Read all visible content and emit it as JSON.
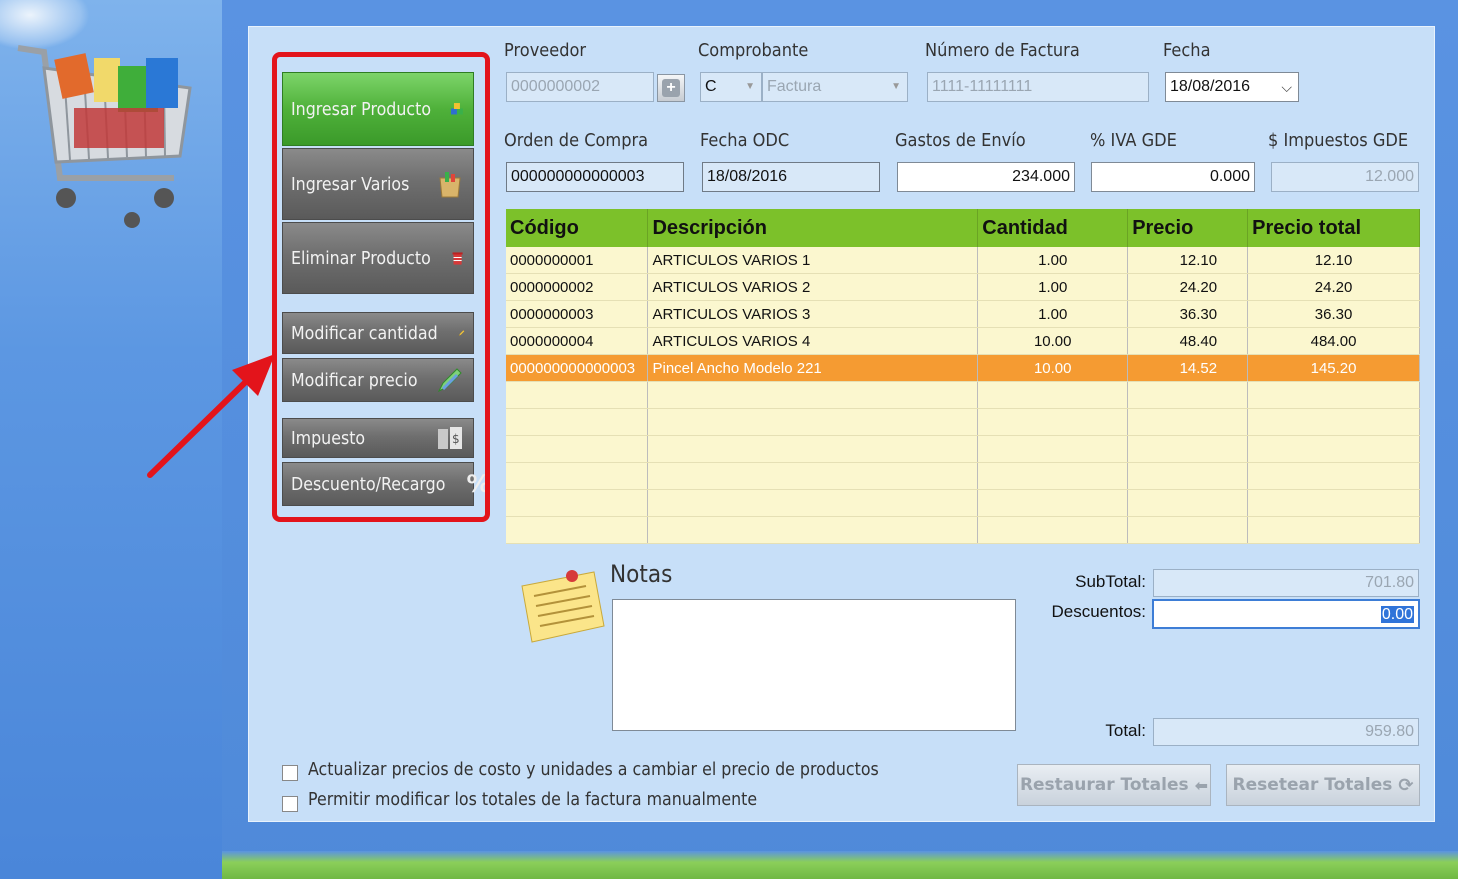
{
  "header": {
    "proveedor_label": "Proveedor",
    "proveedor_value": "0000000002",
    "comprobante_label": "Comprobante",
    "comprobante_letra": "C",
    "comprobante_tipo": "Factura",
    "numero_label": "Número de Factura",
    "numero_value": "1111-11111111",
    "fecha_label": "Fecha",
    "fecha_value": "18/08/2016",
    "orden_label": "Orden de Compra",
    "orden_value": "000000000000003",
    "fecha_odc_label": "Fecha ODC",
    "fecha_odc_value": "18/08/2016",
    "gastos_label": "Gastos de Envío",
    "gastos_value": "234.000",
    "iva_label": "% IVA GDE",
    "iva_value": "0.000",
    "impuestos_label": "$ Impuestos GDE",
    "impuestos_value": "12.000"
  },
  "sidebar": {
    "buttons": [
      {
        "label": "Ingresar Producto"
      },
      {
        "label": "Ingresar Varios"
      },
      {
        "label": "Eliminar Producto"
      },
      {
        "label": "Modificar cantidad"
      },
      {
        "label": "Modificar precio"
      },
      {
        "label": "Impuesto"
      },
      {
        "label": "Descuento/Recargo"
      }
    ]
  },
  "table": {
    "columns": [
      "Código",
      "Descripción",
      "Cantidad",
      "Precio",
      "Precio total"
    ],
    "rows": [
      [
        "0000000001",
        "ARTICULOS VARIOS 1",
        "1.00",
        "12.10",
        "12.10"
      ],
      [
        "0000000002",
        "ARTICULOS VARIOS 2",
        "1.00",
        "24.20",
        "24.20"
      ],
      [
        "0000000003",
        "ARTICULOS VARIOS 3",
        "1.00",
        "36.30",
        "36.30"
      ],
      [
        "0000000004",
        "ARTICULOS VARIOS 4",
        "10.00",
        "48.40",
        "484.00"
      ],
      [
        "000000000000003",
        "Pincel Ancho Modelo 221",
        "10.00",
        "14.52",
        "145.20"
      ]
    ]
  },
  "notes": {
    "label": "Notas",
    "value": ""
  },
  "totals": {
    "subtotal_label": "SubTotal:",
    "subtotal_value": "701.80",
    "descuentos_label": "Descuentos:",
    "descuentos_value": "0.00",
    "total_label": "Total:",
    "total_value": "959.80"
  },
  "options": {
    "actualizar_label": "Actualizar precios de costo y unidades a cambiar el precio de productos",
    "permitir_label": "Permitir modificar los totales de la factura manualmente"
  },
  "actions": {
    "restaurar_label": "Restaurar Totales",
    "resetear_label": "Resetear Totales"
  },
  "colors": {
    "header_green": "#7cc12a",
    "selected_row": "#f59b32",
    "highlight_frame": "#e3141b",
    "primary_button": "#4fb13a"
  }
}
